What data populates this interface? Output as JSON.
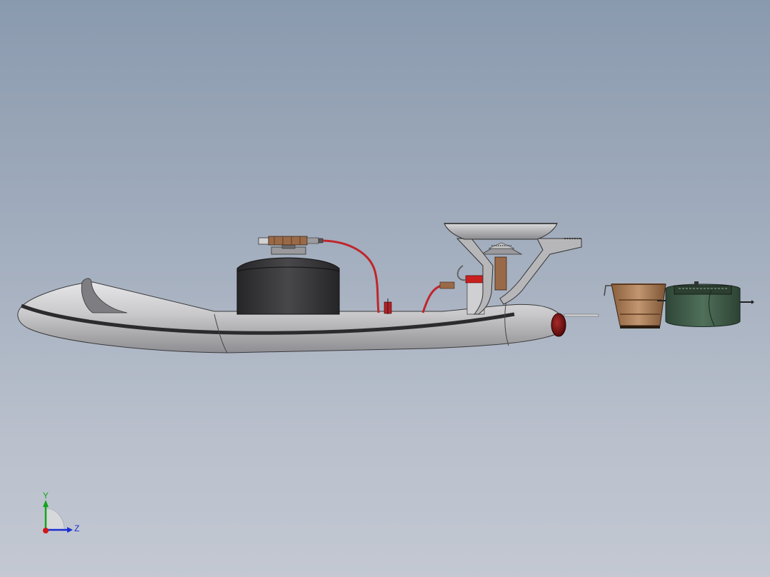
{
  "viewport": {
    "background_top": "#8a9aae",
    "background_bottom": "#c3c8d2"
  },
  "model": {
    "parts": [
      "hull-body",
      "gas-canister",
      "regulator-valve",
      "fuel-hose",
      "stove-burner",
      "pot-support",
      "cooking-pan",
      "ignition-cap",
      "wooden-bucket",
      "green-pot"
    ],
    "colors": {
      "hull": "#c9c9cb",
      "canister": "#3a3a3c",
      "hose": "#c0262c",
      "copper": "#9a6a48",
      "bucket": "#a87b55",
      "green_pot": "#3f5a46",
      "nose_cap": "#6e1010"
    }
  },
  "triad": {
    "y_label": "Y",
    "z_label": "Z",
    "y_color": "#12a41c",
    "z_color": "#1a2fd0",
    "origin_color": "#d01818"
  }
}
